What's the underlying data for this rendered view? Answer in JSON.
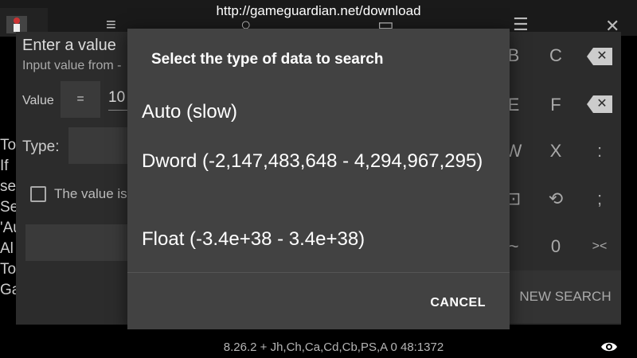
{
  "overlay_url": "http://gameguardian.net/download",
  "bg_dialog": {
    "title": "Enter a value",
    "subtitle": "Input value from -",
    "value_label": "Value",
    "equals_label": "=",
    "value_input": "10",
    "type_label": "Type:",
    "checkbox_label": "The value is"
  },
  "bg_text_lines": [
    "To",
    "If",
    "se",
    "Se",
    "'Au",
    "Al",
    "To",
    "Ga"
  ],
  "keypad": {
    "row1": [
      "B",
      "C"
    ],
    "row2": [
      "E",
      "F"
    ],
    "row3": [
      "W",
      "X",
      ":"
    ],
    "row4": [
      ";"
    ],
    "row5": [
      "~",
      "0",
      "><"
    ],
    "new_search": "NEW SEARCH"
  },
  "modal": {
    "title": "Select the type of data to search",
    "options": [
      "Auto (slow)",
      "Dword (-2,147,483,648 - 4,294,967,295)",
      "Float (-3.4e+38 - 3.4e+38)"
    ],
    "cancel_label": "CANCEL"
  },
  "status_bar": {
    "text": "8.26.2  + Jh,Ch,Ca,Cd,Cb,PS,A  0  48:1372"
  },
  "colors": {
    "modal_bg": "#424242",
    "dialog_bg": "#2c2c2c",
    "text": "#ffffff"
  }
}
